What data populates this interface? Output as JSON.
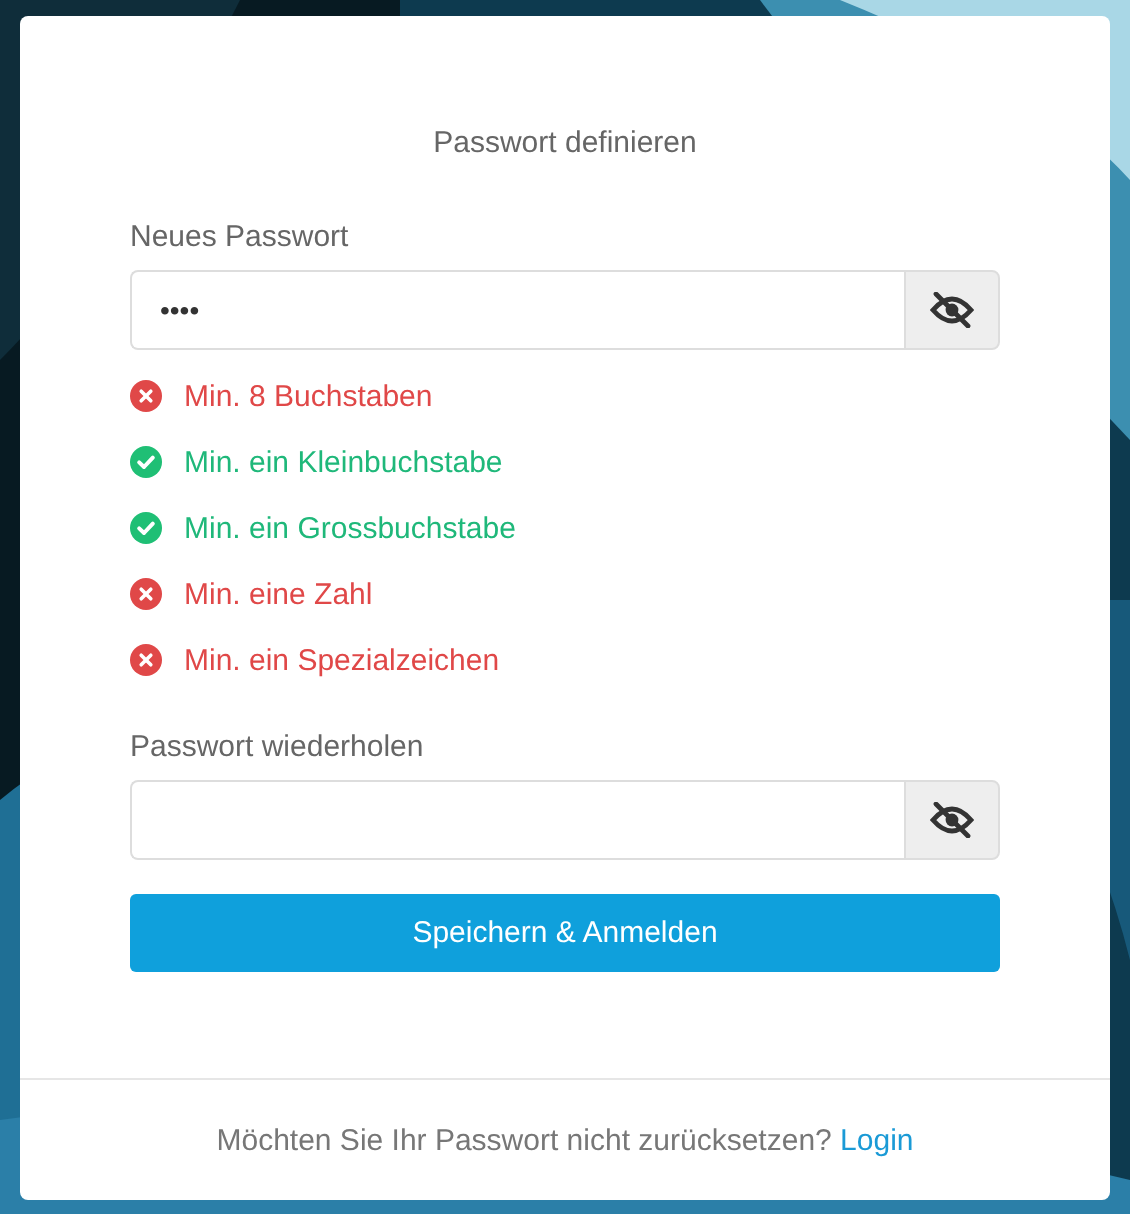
{
  "title": "Passwort definieren",
  "new_password": {
    "label": "Neues Passwort",
    "value": "••••"
  },
  "rules": [
    {
      "text": "Min. 8 Buchstaben",
      "met": false
    },
    {
      "text": "Min. ein Kleinbuchstabe",
      "met": true
    },
    {
      "text": "Min. ein Grossbuchstabe",
      "met": true
    },
    {
      "text": "Min. eine Zahl",
      "met": false
    },
    {
      "text": "Min. ein Spezialzeichen",
      "met": false
    }
  ],
  "repeat_password": {
    "label": "Passwort wiederholen"
  },
  "submit": "Speichern & Anmelden",
  "footer": {
    "text": "Möchten Sie Ihr Passwort nicht zurücksetzen?",
    "link": "Login"
  }
}
